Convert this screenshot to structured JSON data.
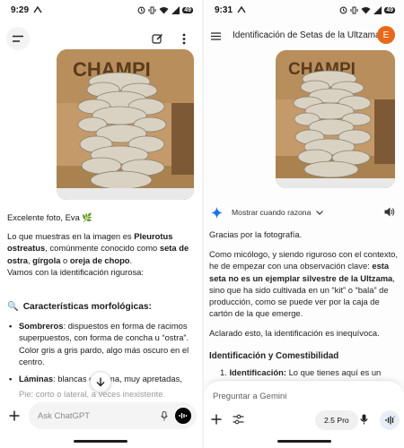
{
  "left": {
    "status": {
      "time": "9:29",
      "battery": "49"
    },
    "message": {
      "greeting": "Excelente foto, Eva 🌿",
      "intro_prefix": "Lo que muestras en la imagen es ",
      "species": "Pleurotus ostreatus",
      "intro_mid": ", comúnmente conocido como ",
      "name1": "seta de ostra",
      "sep1": ", ",
      "name2": "gírgola",
      "sep2": " o ",
      "name3": "oreja de chopo",
      "intro_end": ".",
      "line2": "Vamos con la identificación rigurosa:",
      "section_icon": "🔍",
      "section_title": "Características morfológicas:",
      "bullets": [
        {
          "bold": "Sombreros",
          "text": ": dispuestos en forma de racimos superpuestos, con forma de concha u “ostra”. Color gris a gris pardo, algo más oscuro en el centro."
        },
        {
          "bold": "Láminas",
          "text": ": blancas o crema, muy apretadas,"
        }
      ],
      "faded_line": "Pie: corto o lateral, a veces inexistente."
    },
    "composer": {
      "placeholder": "Ask ChatGPT"
    }
  },
  "right": {
    "status": {
      "time": "9:31",
      "battery": "49"
    },
    "header": {
      "title": "Identificación de Setas de la Ultzama",
      "avatar_letter": "E"
    },
    "thinking_label": "Mostrar cuando razona",
    "message": {
      "p1": "Gracias por la fotografía.",
      "p2_start": "Como micólogo, y siendo riguroso con el contexto, he de empezar con una observación clave: ",
      "p2_bold": "esta seta no es un ejemplar silvestre de la Ultzama",
      "p2_end": ", sino que ha sido cultivada en un “kit” o “bala” de producción, como se puede ver por la caja de cartón de la que emerge.",
      "p3": "Aclarado esto, la identificación es inequívoca.",
      "section_title": "Identificación y Comestibilidad",
      "item_num": "1.",
      "item_bold": "Identificación:",
      "item_text": " Lo que tienes aquí es un"
    },
    "composer": {
      "placeholder": "Preguntar a Gemini",
      "model": "2.5 Pro"
    }
  },
  "photo_box_text": "CHAMPI",
  "colors": {
    "gemini_avatar": "#e76a1b",
    "accent_blue": "#1a73e8"
  }
}
